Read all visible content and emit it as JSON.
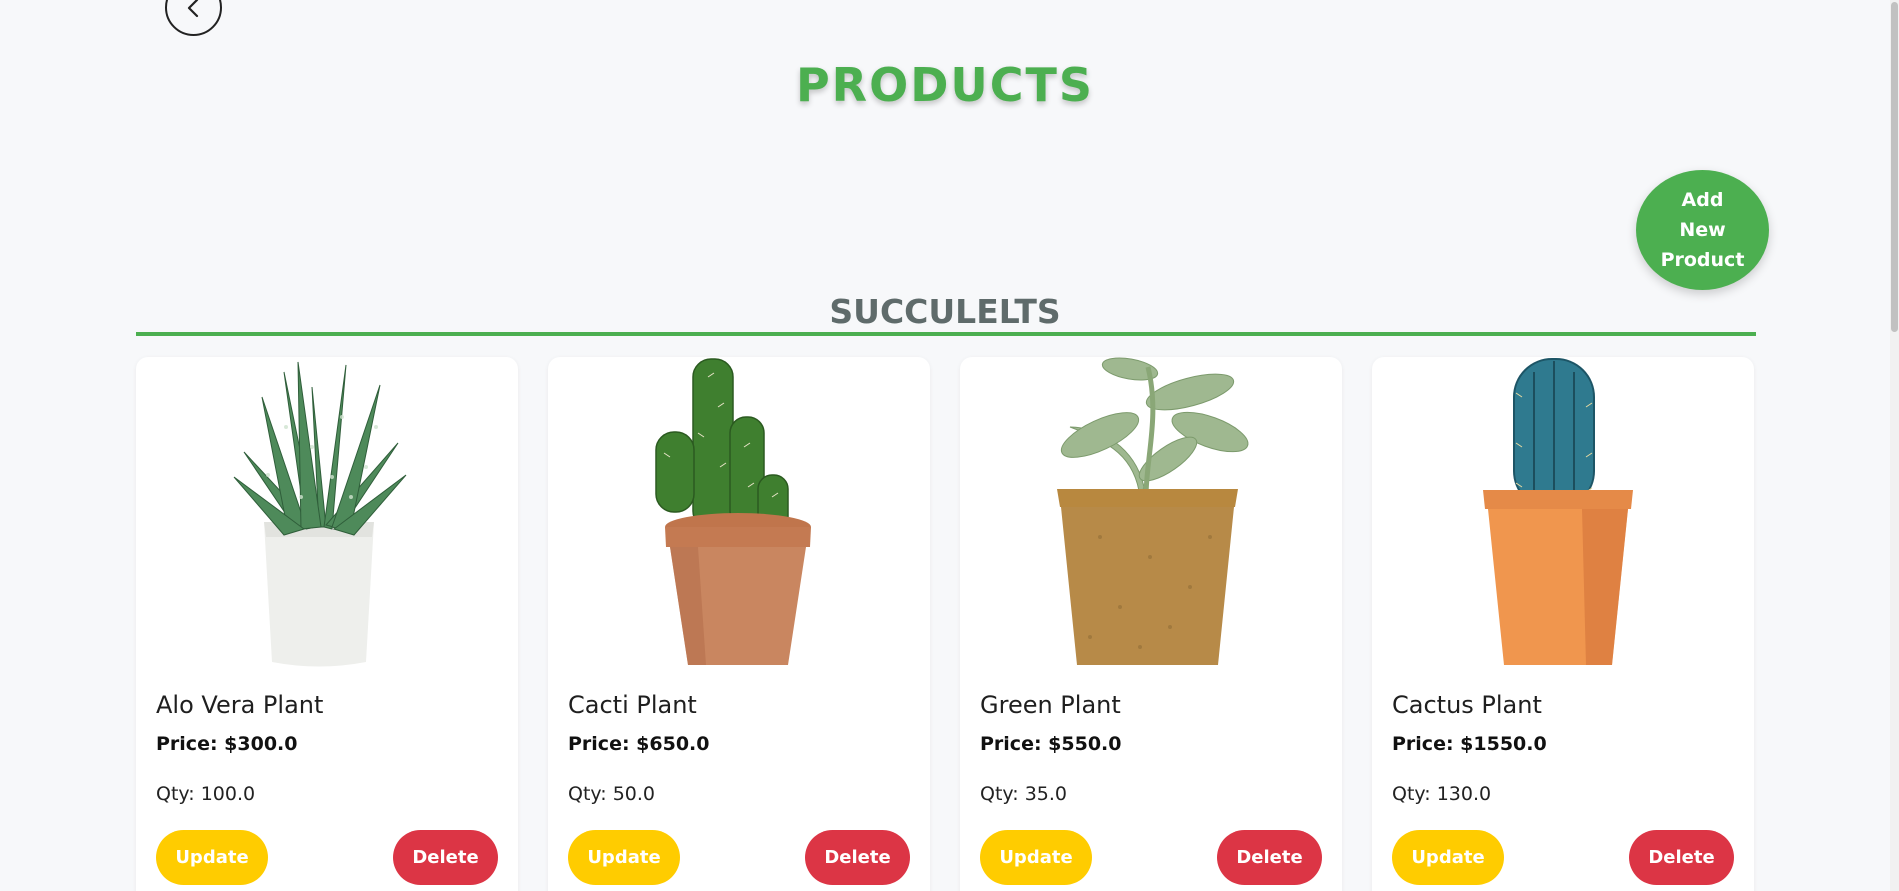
{
  "header": {
    "title": "PRODUCTS",
    "back_icon": "chevron-left-icon"
  },
  "add_button": {
    "lines": [
      "Add",
      "New",
      "Product"
    ]
  },
  "category": {
    "title": "SUCCULELTS"
  },
  "colors": {
    "accent": "#4caf50",
    "update": "#ffcc00",
    "delete": "#dc3545",
    "background": "#f7f8fa",
    "category_text": "#5f6b6b"
  },
  "products": [
    {
      "name": "Alo Vera Plant",
      "price": "Price: $300.0",
      "qty": "Qty: 100.0",
      "update_label": "Update",
      "delete_label": "Delete",
      "image": "aloe-plant-in-white-pot"
    },
    {
      "name": "Cacti Plant",
      "price": "Price: $650.0",
      "qty": "Qty: 50.0",
      "update_label": "Update",
      "delete_label": "Delete",
      "image": "cactus-in-terracotta-pot"
    },
    {
      "name": "Green Plant",
      "price": "Price: $550.0",
      "qty": "Qty: 35.0",
      "update_label": "Update",
      "delete_label": "Delete",
      "image": "leafy-plant-in-fiber-pot"
    },
    {
      "name": "Cactus Plant",
      "price": "Price: $1550.0",
      "qty": "Qty: 130.0",
      "update_label": "Update",
      "delete_label": "Delete",
      "image": "blue-cactus-in-orange-pot"
    }
  ]
}
